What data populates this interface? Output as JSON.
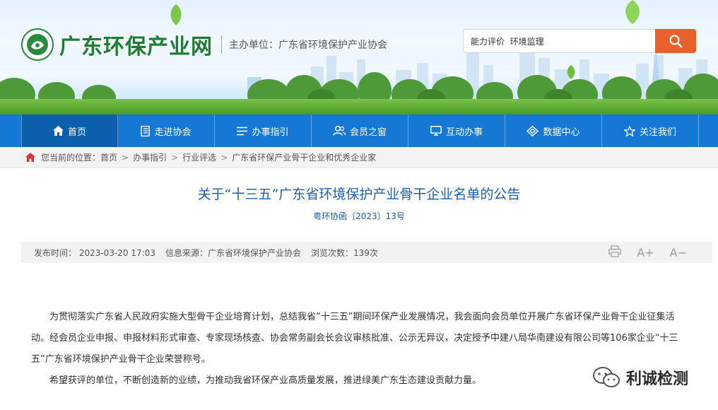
{
  "header": {
    "site_title": "广东环保产业网",
    "sponsor": "主办单位：广东省环境保护产业协会",
    "search_value": "能力评价  环境监理",
    "colors": {
      "brand_green": "#1f7d33",
      "search_button": "#e8612c"
    }
  },
  "nav": {
    "color": "#1478d4",
    "items": [
      {
        "label": "首页",
        "icon": "home-icon"
      },
      {
        "label": "走进协会",
        "icon": "book-icon"
      },
      {
        "label": "办事指引",
        "icon": "list-icon"
      },
      {
        "label": "会员之窗",
        "icon": "users-icon"
      },
      {
        "label": "互动办事",
        "icon": "monitor-icon"
      },
      {
        "label": "数据中心",
        "icon": "data-icon"
      },
      {
        "label": "关注我们",
        "icon": "star-icon"
      }
    ]
  },
  "breadcrumb": {
    "prefix": "您当前的位置：",
    "items": [
      "首页",
      "办事指引",
      "行业评选",
      "广东省环保产业骨干企业和优秀企业家"
    ]
  },
  "article": {
    "title": "关于“十三五”广东省环境保护产业骨干企业名单的公告",
    "doc_number": "粤环协函〔2023〕13号",
    "meta": {
      "publish_time": "发布时间： 2023-03-20 17:03",
      "source": "信息来源：广东省环境保护产业协会",
      "views": "浏览次数：139次"
    },
    "tools": {
      "font_up": "A+",
      "font_down": "A−"
    },
    "paragraphs": [
      "为贯彻落实广东省人民政府实施大型骨干企业培育计划，总结我省“十三五”期间环保产业发展情况，我会面向会员单位开展广东省环保产业骨干企业征集活动。经会员企业申报、申报材料形式审查、专家现场核查、协会常务副会长会议审核批准、公示无异议，决定授予中建八局华南建设有限公司等106家企业“十三五”广东省环境保护产业骨干企业荣誉称号。",
      "希望获评的单位，不断创造新的业绩，为推动我省环保产业高质量发展，推进绿美广东生态建设贡献力量。"
    ]
  },
  "watermark": {
    "text": "利诚检测"
  }
}
